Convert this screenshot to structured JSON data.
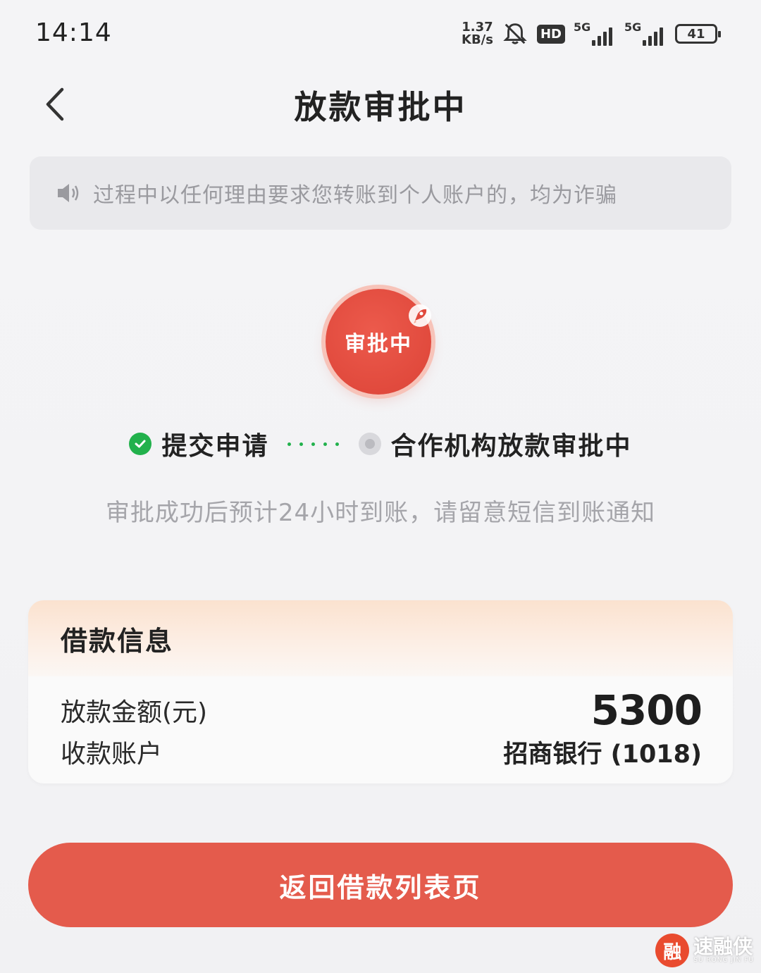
{
  "status_bar": {
    "time": "14:14",
    "net_speed_value": "1.37",
    "net_speed_unit": "KB/s",
    "hd_badge": "HD",
    "signal_1_label": "5G",
    "signal_2_label": "5G",
    "battery": "41",
    "icons": [
      "bell-muted-icon",
      "signal-icon",
      "battery-icon"
    ]
  },
  "header": {
    "title": "放款审批中",
    "back_icon": "chevron-left-icon"
  },
  "notice": {
    "icon": "speaker-icon",
    "text": "过程中以任何理由要求您转账到个人账户的，均为诈骗"
  },
  "status": {
    "label": "审批中",
    "icon": "rocket-icon",
    "accent_color": "#e14a3d"
  },
  "steps": [
    {
      "label": "提交申请",
      "state": "done",
      "icon": "check-circle-icon",
      "color": "#22b14c"
    },
    {
      "label": "合作机构放款审批中",
      "state": "pending",
      "icon": "pending-circle-icon",
      "color": "#c8c8cc"
    }
  ],
  "sub_note": "审批成功后预计24小时到账，请留意短信到账通知",
  "loan_info": {
    "title": "借款信息",
    "amount_label": "放款金额(元)",
    "amount_value": "5300",
    "account_label": "收款账户",
    "account_value": "招商银行 (1018)"
  },
  "primary_button": {
    "label": "返回借款列表页",
    "color": "#e45b4c"
  },
  "watermark": {
    "logo_char": "融",
    "text": "速融侠",
    "sub": "SU RONG JIN FU"
  }
}
